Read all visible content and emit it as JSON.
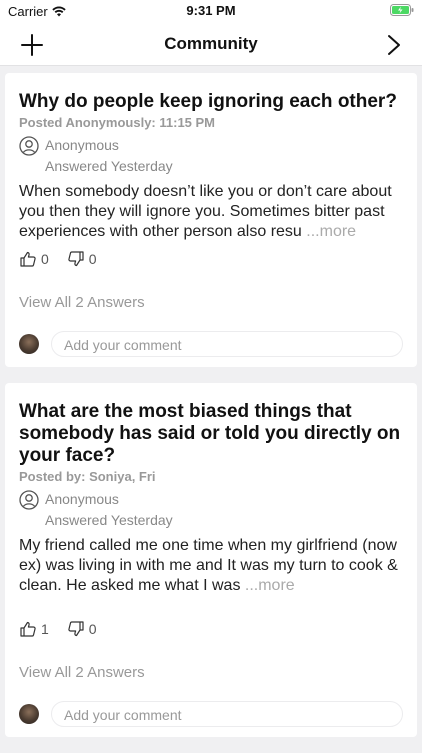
{
  "status": {
    "carrier": "Carrier",
    "time": "9:31 PM"
  },
  "nav": {
    "title": "Community",
    "add_icon": "plus-icon",
    "next_icon": "chevron-right-icon"
  },
  "posts": [
    {
      "title": "Why do people keep ignoring each other?",
      "posted": "Posted Anonymously: 11:15 PM",
      "author": "Anonymous",
      "answered": "Answered Yesterday",
      "answer": "When somebody doesn’t like you or don’t care about you then they will ignore you. Sometimes bitter past experiences with other person also resu",
      "more": "...more",
      "likes": "0",
      "dislikes": "0",
      "view_all": "View All 2 Answers",
      "comment_placeholder": "Add your comment"
    },
    {
      "title": "What are the most biased things that somebody has said or told you directly on your face?",
      "posted": "Posted by: Soniya, Fri",
      "author": "Anonymous",
      "answered": "Answered Yesterday",
      "answer": "My friend called me one time when my girlfriend (now ex) was living in with me and It was my turn to cook & clean. He asked me what I was",
      "more": "...more",
      "likes": "1",
      "dislikes": "0",
      "view_all": "View All 2 Answers",
      "comment_placeholder": "Add your comment"
    }
  ]
}
